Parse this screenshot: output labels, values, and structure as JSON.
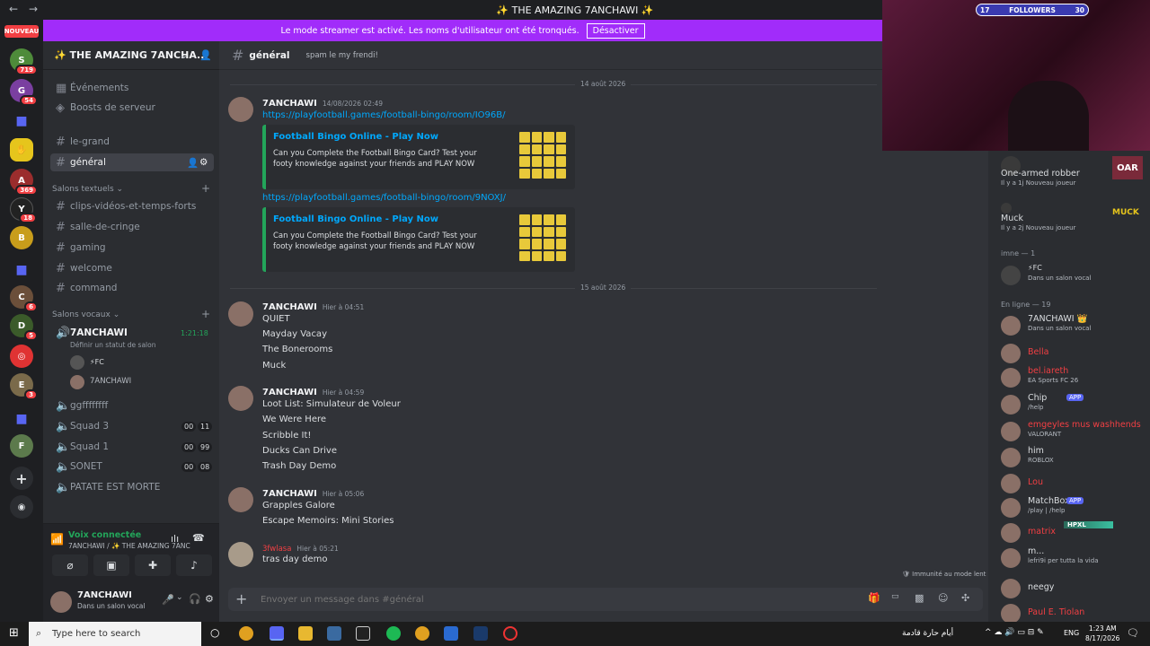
{
  "titlebar": {
    "title": "✨ THE AMAZING 7ANCHAWI ✨"
  },
  "rail": {
    "new_label": "NOUVEAU",
    "badges": [
      "719",
      "54",
      "369",
      "18",
      "6",
      "5",
      "3"
    ]
  },
  "banner": {
    "text": "Le mode streamer est activé. Les noms d'utilisateur ont été tronqués.",
    "button": "Désactiver"
  },
  "guild": {
    "name": "✨ THE AMAZING 7ANCHA..."
  },
  "sidebar": {
    "events": "Événements",
    "boosts": "Boosts de serveur",
    "text_channels_top": [
      "le-grand",
      "général"
    ],
    "text_category": "Salons textuels",
    "text_channels": [
      "clips-vidéos-et-temps-forts",
      "salle-de-cringe",
      "gaming",
      "welcome",
      "command"
    ],
    "voice_category": "Salons vocaux",
    "voice_active": {
      "name": "7ANCHAWI",
      "timer": "1:21:18",
      "status": "Définir un statut de salon"
    },
    "voice_users": [
      "FC",
      "7ANCHAWI"
    ],
    "voice_channels": [
      {
        "name": "ggffffffff",
        "a": "",
        "b": ""
      },
      {
        "name": "Squad 3",
        "a": "00",
        "b": "11"
      },
      {
        "name": "Squad 1",
        "a": "00",
        "b": "99"
      },
      {
        "name": "SONET",
        "a": "00",
        "b": "08"
      },
      {
        "name": "PATATE EST MORTE",
        "a": "",
        "b": ""
      }
    ]
  },
  "voice_panel": {
    "status": "Voix connectée",
    "sub": "7ANCHAWI / ✨ THE AMAZING 7ANC..."
  },
  "user_panel": {
    "name": "7ANCHAWI",
    "status": "Dans un salon vocal"
  },
  "chat": {
    "channel": "général",
    "topic": "spam le my frendi!",
    "date1": "14 août 2026",
    "date2": "15 août 2026",
    "m1": {
      "author": "7ANCHAWI",
      "time": "14/08/2026 02:49",
      "link1": "https://playfootball.games/football-bingo/room/IO96B/",
      "link2": "https://playfootball.games/football-bingo/room/9NOXJ/"
    },
    "embed": {
      "title": "Football Bingo Online - Play Now",
      "desc": "Can you Complete the Football Bingo Card? Test your footy knowledge against your friends and PLAY NOW"
    },
    "m2": {
      "author": "7ANCHAWI",
      "time": "Hier à 04:51",
      "lines": [
        "QUIET",
        "Mayday Vacay",
        "The Bonerooms",
        "Muck"
      ]
    },
    "m3": {
      "author": "7ANCHAWI",
      "time": "Hier à 04:59",
      "lines": [
        "Loot List: Simulateur de Voleur",
        "We Were Here",
        "Scribble It!",
        "Ducks Can Drive",
        "Trash Day Demo"
      ]
    },
    "m4": {
      "author": "7ANCHAWI",
      "time": "Hier à 05:06",
      "lines": [
        "Grapples Galore",
        "Escape Memoirs: Mini Stories"
      ]
    },
    "m5": {
      "author": "3fwlasa",
      "time": "Hier à 05:21",
      "lines": [
        "tras day demo"
      ]
    },
    "placeholder": "Envoyer un message dans #général",
    "immunity": "Immunité au mode lent"
  },
  "webcam": {
    "followers_label": "FOLLOWERS",
    "count_left": "17",
    "count_right": "30"
  },
  "members": {
    "top": [
      {
        "name": "One-armed robber",
        "status": "Il y a 1j  Nouveau joueur",
        "game": "OAR"
      },
      {
        "name": "Muck",
        "status": "Il y a 2j  Nouveau joueur",
        "game": "MUCK"
      }
    ],
    "cat_imne": "imne — 1",
    "imne_member": {
      "name": "FC",
      "status": "Dans un salon vocal"
    },
    "cat_online": "En ligne — 19",
    "online": [
      {
        "name": "7ANCHAWI 👑",
        "status": "Dans un salon vocal",
        "color": "#dbdee1"
      },
      {
        "name": "Bella",
        "status": "",
        "color": "#f23f43"
      },
      {
        "name": "bel.iareth",
        "status": "EA Sports FC 26",
        "color": "#f23f43"
      },
      {
        "name": "Chip",
        "status": "/help",
        "color": "#dbdee1",
        "app": "APP"
      },
      {
        "name": "emgeyles mus washhends",
        "status": "VALORANT",
        "color": "#f23f43"
      },
      {
        "name": "him",
        "status": "ROBLOX",
        "color": "#dbdee1"
      },
      {
        "name": "Lou",
        "status": "",
        "color": "#f23f43"
      },
      {
        "name": "MatchBox",
        "status": "/play | /help",
        "color": "#dbdee1",
        "app": "APP"
      },
      {
        "name": "matrix",
        "status": "",
        "color": "#f23f43",
        "tag": "HPXL"
      },
      {
        "name": "m...",
        "status": "lefri9i per tutta la vida",
        "color": "#dbdee1"
      },
      {
        "name": "neegy",
        "status": "",
        "color": "#dbdee1"
      },
      {
        "name": "Paul E. Tiolan",
        "status": "",
        "color": "#f23f43"
      }
    ]
  },
  "taskbar": {
    "search": "Type here to search",
    "clock_time": "1:23 AM",
    "clock_date": "8/17/2026",
    "lang": "ENG",
    "weather": "أيام حارة قادمة"
  },
  "colors": {
    "accent": "#a12cfa",
    "link": "#00a8fc",
    "embed_border": "#23a55a"
  }
}
